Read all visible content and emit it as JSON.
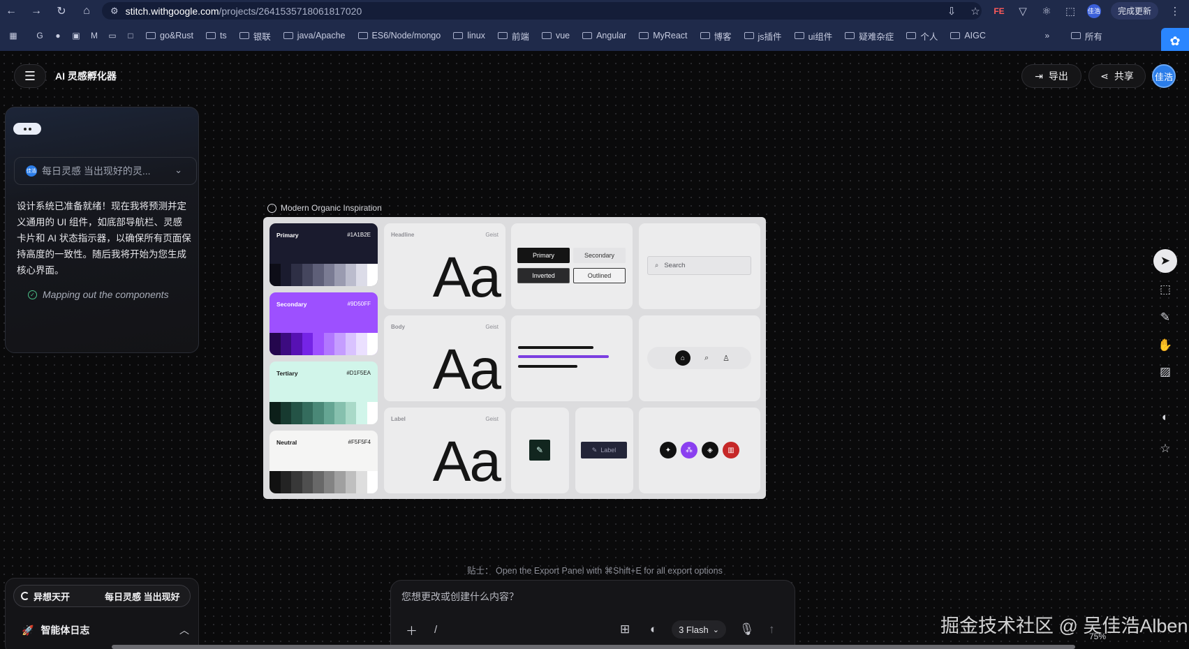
{
  "browser": {
    "url_host": "stitch.withgoogle.com",
    "url_path": "/projects/2641535718061817020",
    "update_label": "完成更新",
    "bookmarks": [
      "go&Rust",
      "ts",
      "银联",
      "java/Apache",
      "ES6/Node/mongo",
      "linux",
      "前端",
      "vue",
      "Angular",
      "MyReact",
      "博客",
      "js插件",
      "ui组件",
      "疑难杂症",
      "个人",
      "AIGC"
    ],
    "bookmarks_more": "所有",
    "avatar_mini": "佳浩"
  },
  "header": {
    "title": "AI 灵感孵化器",
    "export_label": "导出",
    "share_label": "共享",
    "avatar": "佳浩"
  },
  "chat": {
    "select_text": "每日灵感 当出现好的灵...",
    "select_avatar": "佳浩",
    "message": "设计系统已准备就绪！现在我将预测并定义通用的 UI 组件，如底部导航栏、灵感卡片和 AI 状态指示器，以确保所有页面保持高度的一致性。随后我将开始为您生成核心界面。",
    "status": "Mapping out the components"
  },
  "bottom_left": {
    "tab_a": "异想天开",
    "tab_b": "每日灵感 当出现好",
    "agent_log": "智能体日志"
  },
  "board": {
    "label": "Modern Organic Inspiration",
    "swatches": [
      {
        "name": "Primary",
        "hex": "#1A1B2E",
        "bg": "#1a1b2e",
        "fg": "#ffffff",
        "strip": [
          "#0d0d17",
          "#1a1b2e",
          "#2e2f45",
          "#45465e",
          "#5e5f78",
          "#7a7b93",
          "#9a9bb0",
          "#bbbccd",
          "#dcdce8",
          "#ffffff"
        ]
      },
      {
        "name": "Secondary",
        "hex": "#9D50FF",
        "bg": "#9d50ff",
        "fg": "#ffffff",
        "strip": [
          "#24064d",
          "#3c0b80",
          "#5711b3",
          "#7524e6",
          "#9d50ff",
          "#b177ff",
          "#c59dff",
          "#d9c2ff",
          "#ebe0ff",
          "#ffffff"
        ]
      },
      {
        "name": "Tertiary",
        "hex": "#D1F5EA",
        "bg": "#d1f5ea",
        "fg": "#1a1a1a",
        "strip": [
          "#0c1f19",
          "#173a30",
          "#245346",
          "#346c5d",
          "#4a8877",
          "#65a593",
          "#86c0ae",
          "#a9d9c8",
          "#d1f5ea",
          "#ffffff"
        ]
      },
      {
        "name": "Neutral",
        "hex": "#F5F5F4",
        "bg": "#f5f5f4",
        "fg": "#1a1a1a",
        "strip": [
          "#111111",
          "#232323",
          "#383838",
          "#4f4f4f",
          "#686868",
          "#838383",
          "#a0a0a0",
          "#bfbfbf",
          "#dedede",
          "#ffffff"
        ]
      }
    ],
    "typography": [
      {
        "role": "Headline",
        "font": "Geist",
        "sample": "Aa"
      },
      {
        "role": "Body",
        "font": "Geist",
        "sample": "Aa"
      },
      {
        "role": "Label",
        "font": "Geist",
        "sample": "Aa"
      }
    ],
    "buttons": {
      "primary": "Primary",
      "secondary": "Secondary",
      "inverted": "Inverted",
      "outlined": "Outlined"
    },
    "search_placeholder": "Search",
    "chip_label": "Label",
    "accent_color": "#9d50ff",
    "danger_color": "#d32f2f"
  },
  "prompt": {
    "tip_prefix": "贴士：",
    "tip": "Open the Export Panel with ⌘Shift+E for all export options",
    "placeholder": "您想更改或创建什么内容？",
    "model": "3 Flash"
  },
  "watermark": "掘金技术社区 @ 吴佳浩Alben",
  "zoom": "75%"
}
